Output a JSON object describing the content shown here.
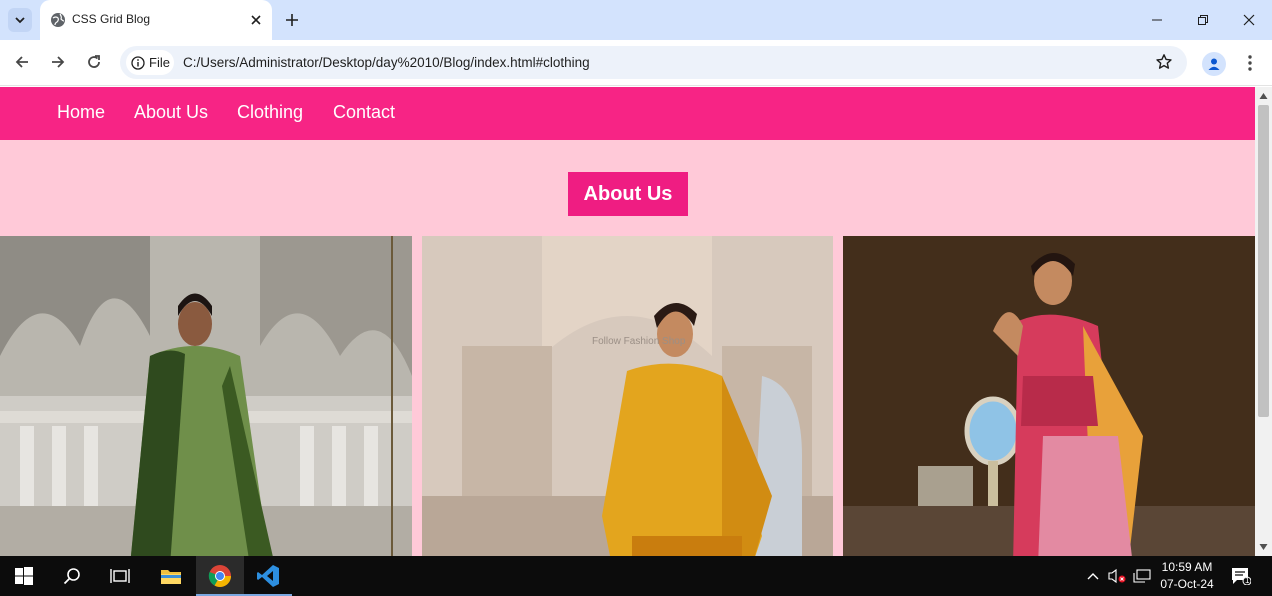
{
  "browser": {
    "tab_title": "CSS Grid Blog",
    "url": "C:/Users/Administrator/Desktop/day%2010/Blog/index.html#clothing",
    "site_info_chip": "File"
  },
  "site": {
    "nav": [
      "Home",
      "About Us",
      "Clothing",
      "Contact"
    ],
    "section_heading": "About Us",
    "accent_color": "#f72485",
    "background_color": "#ffc9d8"
  },
  "photos": [
    {
      "description": "green-saree-model",
      "watermark": ""
    },
    {
      "description": "yellow-silk-saree-model",
      "watermark": "Follow Fashion Shop"
    },
    {
      "description": "pink-bridal-saree-model",
      "watermark": ""
    }
  ],
  "taskbar": {
    "time": "10:59 AM",
    "date": "07-Oct-24",
    "notification_count": "1"
  }
}
